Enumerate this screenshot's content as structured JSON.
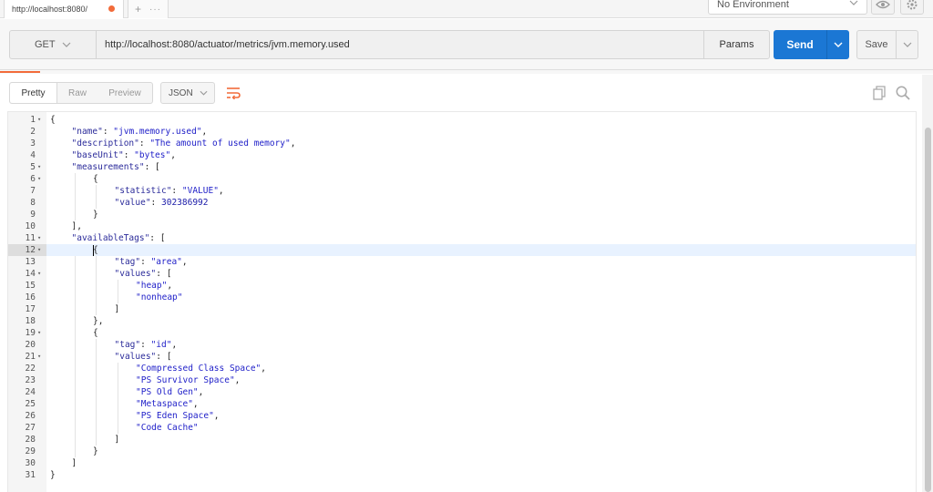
{
  "tab": {
    "title": "http://localhost:8080/",
    "new_tab_glyph": "+",
    "more_glyph": "···"
  },
  "environment": {
    "selected": "No Environment"
  },
  "request": {
    "method": "GET",
    "url": "http://localhost:8080/actuator/metrics/jvm.memory.used",
    "params_label": "Params",
    "send_label": "Send",
    "save_label": "Save"
  },
  "response": {
    "view_tabs": [
      "Pretty",
      "Raw",
      "Preview"
    ],
    "active_view": "Pretty",
    "format": "JSON",
    "active_line": 12,
    "lines": [
      {
        "n": 1,
        "indent": 0,
        "fold": true,
        "parts": [
          [
            "p",
            "{"
          ]
        ]
      },
      {
        "n": 2,
        "indent": 1,
        "fold": false,
        "parts": [
          [
            "k",
            "\"name\""
          ],
          [
            "p",
            ": "
          ],
          [
            "s",
            "\"jvm.memory.used\""
          ],
          [
            "p",
            ","
          ]
        ]
      },
      {
        "n": 3,
        "indent": 1,
        "fold": false,
        "parts": [
          [
            "k",
            "\"description\""
          ],
          [
            "p",
            ": "
          ],
          [
            "s",
            "\"The amount of used memory\""
          ],
          [
            "p",
            ","
          ]
        ]
      },
      {
        "n": 4,
        "indent": 1,
        "fold": false,
        "parts": [
          [
            "k",
            "\"baseUnit\""
          ],
          [
            "p",
            ": "
          ],
          [
            "s",
            "\"bytes\""
          ],
          [
            "p",
            ","
          ]
        ]
      },
      {
        "n": 5,
        "indent": 1,
        "fold": true,
        "parts": [
          [
            "k",
            "\"measurements\""
          ],
          [
            "p",
            ": ["
          ]
        ]
      },
      {
        "n": 6,
        "indent": 2,
        "fold": true,
        "parts": [
          [
            "p",
            "{"
          ]
        ]
      },
      {
        "n": 7,
        "indent": 3,
        "fold": false,
        "parts": [
          [
            "k",
            "\"statistic\""
          ],
          [
            "p",
            ": "
          ],
          [
            "s",
            "\"VALUE\""
          ],
          [
            "p",
            ","
          ]
        ]
      },
      {
        "n": 8,
        "indent": 3,
        "fold": false,
        "parts": [
          [
            "k",
            "\"value\""
          ],
          [
            "p",
            ": "
          ],
          [
            "num",
            "302386992"
          ]
        ]
      },
      {
        "n": 9,
        "indent": 2,
        "fold": false,
        "parts": [
          [
            "p",
            "}"
          ]
        ]
      },
      {
        "n": 10,
        "indent": 1,
        "fold": false,
        "parts": [
          [
            "p",
            "],"
          ]
        ]
      },
      {
        "n": 11,
        "indent": 1,
        "fold": true,
        "parts": [
          [
            "k",
            "\"availableTags\""
          ],
          [
            "p",
            ": ["
          ]
        ]
      },
      {
        "n": 12,
        "indent": 2,
        "fold": true,
        "parts": [
          [
            "p",
            "{"
          ]
        ]
      },
      {
        "n": 13,
        "indent": 3,
        "fold": false,
        "parts": [
          [
            "k",
            "\"tag\""
          ],
          [
            "p",
            ": "
          ],
          [
            "s",
            "\"area\""
          ],
          [
            "p",
            ","
          ]
        ]
      },
      {
        "n": 14,
        "indent": 3,
        "fold": true,
        "parts": [
          [
            "k",
            "\"values\""
          ],
          [
            "p",
            ": ["
          ]
        ]
      },
      {
        "n": 15,
        "indent": 4,
        "fold": false,
        "parts": [
          [
            "s",
            "\"heap\""
          ],
          [
            "p",
            ","
          ]
        ]
      },
      {
        "n": 16,
        "indent": 4,
        "fold": false,
        "parts": [
          [
            "s",
            "\"nonheap\""
          ]
        ]
      },
      {
        "n": 17,
        "indent": 3,
        "fold": false,
        "parts": [
          [
            "p",
            "]"
          ]
        ]
      },
      {
        "n": 18,
        "indent": 2,
        "fold": false,
        "parts": [
          [
            "p",
            "},"
          ]
        ]
      },
      {
        "n": 19,
        "indent": 2,
        "fold": true,
        "parts": [
          [
            "p",
            "{"
          ]
        ]
      },
      {
        "n": 20,
        "indent": 3,
        "fold": false,
        "parts": [
          [
            "k",
            "\"tag\""
          ],
          [
            "p",
            ": "
          ],
          [
            "s",
            "\"id\""
          ],
          [
            "p",
            ","
          ]
        ]
      },
      {
        "n": 21,
        "indent": 3,
        "fold": true,
        "parts": [
          [
            "k",
            "\"values\""
          ],
          [
            "p",
            ": ["
          ]
        ]
      },
      {
        "n": 22,
        "indent": 4,
        "fold": false,
        "parts": [
          [
            "s",
            "\"Compressed Class Space\""
          ],
          [
            "p",
            ","
          ]
        ]
      },
      {
        "n": 23,
        "indent": 4,
        "fold": false,
        "parts": [
          [
            "s",
            "\"PS Survivor Space\""
          ],
          [
            "p",
            ","
          ]
        ]
      },
      {
        "n": 24,
        "indent": 4,
        "fold": false,
        "parts": [
          [
            "s",
            "\"PS Old Gen\""
          ],
          [
            "p",
            ","
          ]
        ]
      },
      {
        "n": 25,
        "indent": 4,
        "fold": false,
        "parts": [
          [
            "s",
            "\"Metaspace\""
          ],
          [
            "p",
            ","
          ]
        ]
      },
      {
        "n": 26,
        "indent": 4,
        "fold": false,
        "parts": [
          [
            "s",
            "\"PS Eden Space\""
          ],
          [
            "p",
            ","
          ]
        ]
      },
      {
        "n": 27,
        "indent": 4,
        "fold": false,
        "parts": [
          [
            "s",
            "\"Code Cache\""
          ]
        ]
      },
      {
        "n": 28,
        "indent": 3,
        "fold": false,
        "parts": [
          [
            "p",
            "]"
          ]
        ]
      },
      {
        "n": 29,
        "indent": 2,
        "fold": false,
        "parts": [
          [
            "p",
            "}"
          ]
        ]
      },
      {
        "n": 30,
        "indent": 1,
        "fold": false,
        "parts": [
          [
            "p",
            "]"
          ]
        ]
      },
      {
        "n": 31,
        "indent": 0,
        "fold": false,
        "parts": [
          [
            "p",
            "}"
          ]
        ]
      }
    ]
  },
  "colors": {
    "accent": "#f26b3a",
    "send": "#1b77d4",
    "active_line": "#e8f2ff"
  },
  "icons": [
    "close-dot-icon",
    "plus-icon",
    "more-icon",
    "chevron-down-icon",
    "eye-icon",
    "gear-icon",
    "wrap-icon",
    "copy-icon",
    "search-icon"
  ]
}
